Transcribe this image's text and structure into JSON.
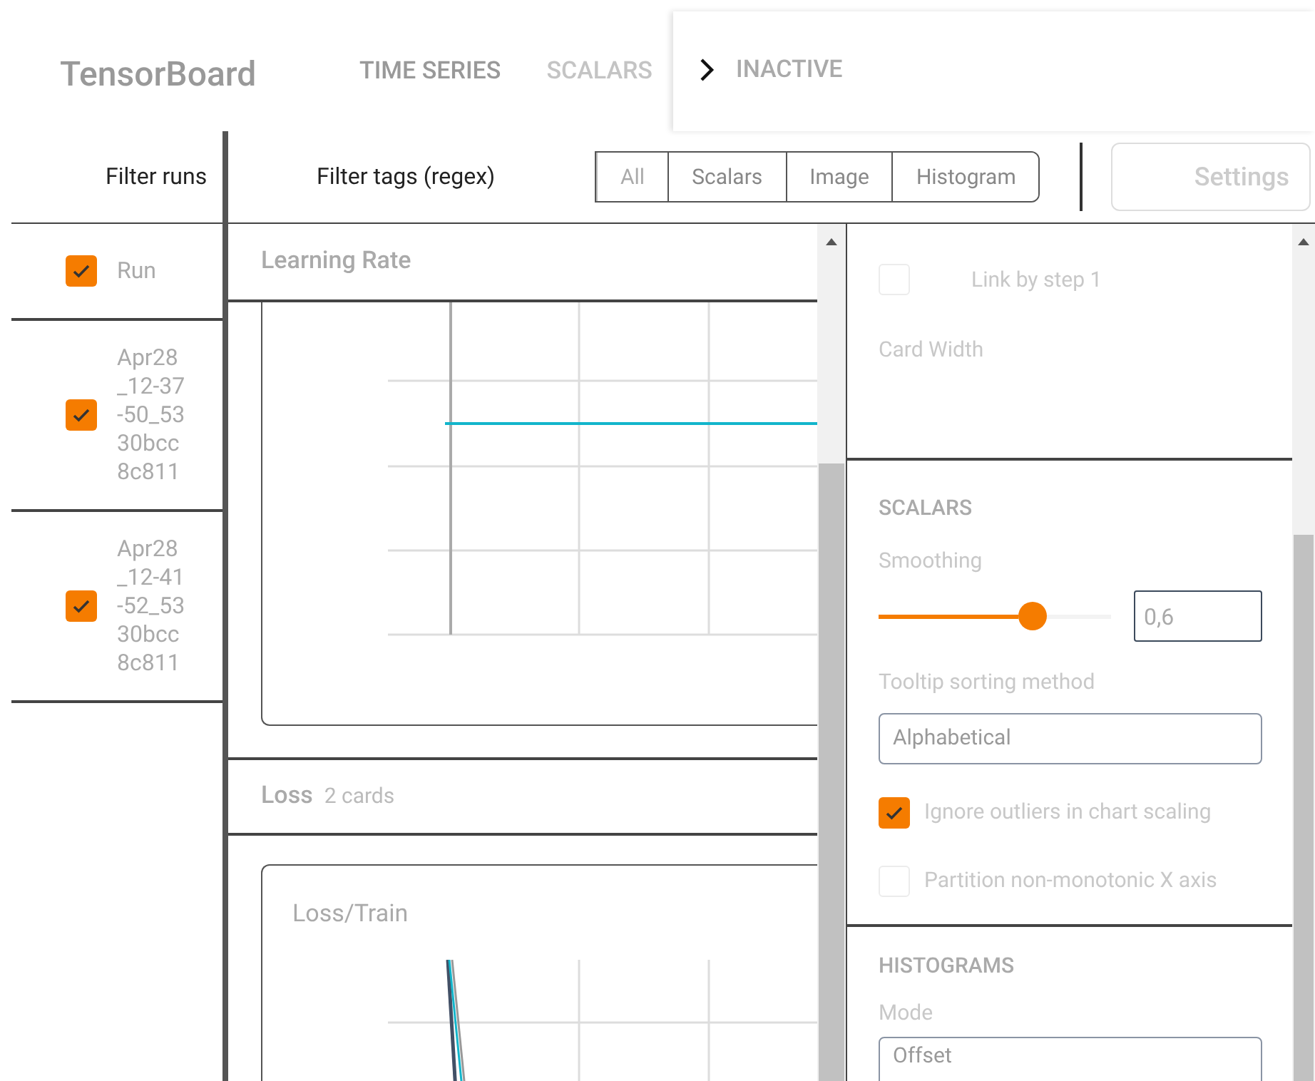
{
  "header": {
    "brand": "TensorBoard",
    "nav": [
      {
        "label": "TIME SERIES",
        "selected": true
      },
      {
        "label": "SCALARS",
        "selected": false
      }
    ],
    "overflow_menu": {
      "label": "INACTIVE"
    }
  },
  "runs_filter": {
    "placeholder": "Filter runs"
  },
  "runs": [
    {
      "name": "Run",
      "checked": true
    },
    {
      "name": "Apr28_12-37-50_5330bcc8c811",
      "checked": true
    },
    {
      "name": "Apr28_12-41-52_5330bcc8c811",
      "checked": true
    }
  ],
  "tags_filter": {
    "placeholder": "Filter tags (regex)"
  },
  "type_tabs": [
    {
      "label": "All",
      "selected": true
    },
    {
      "label": "Scalars",
      "selected": false
    },
    {
      "label": "Image",
      "selected": false
    },
    {
      "label": "Histogram",
      "selected": false
    }
  ],
  "settings_button": "Settings",
  "groups": [
    {
      "title": "Learning Rate",
      "cards": [
        {
          "kind": "chart"
        }
      ]
    },
    {
      "title": "Loss",
      "count": "2 cards",
      "cards": [
        {
          "kind": "chart",
          "title": "Loss/Train"
        }
      ]
    }
  ],
  "settings": {
    "general": [
      {
        "label": "Link by step 1",
        "checked": false
      }
    ],
    "card_width_label": "Card Width",
    "scalars": {
      "title": "SCALARS",
      "smoothing_label": "Smoothing",
      "smoothing": {
        "level": 0.6,
        "value": "0,6"
      },
      "tooltip_label": "Tooltip sorting method",
      "tooltip_value": "Alphabetical",
      "options": [
        {
          "label": "Ignore outliers in chart scaling",
          "checked": true
        },
        {
          "label": "Partition non-monotonic X axis",
          "checked": false
        }
      ]
    },
    "histograms": {
      "title": "HISTOGRAMS",
      "mode_label": "Mode",
      "mode_value": "Offset"
    }
  }
}
